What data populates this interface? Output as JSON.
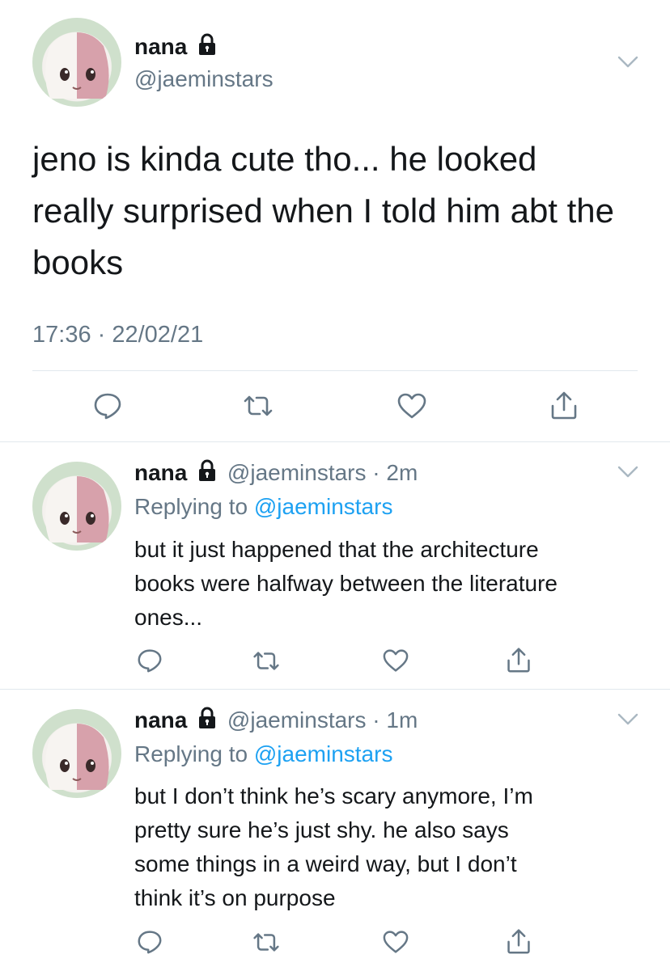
{
  "main_tweet": {
    "display_name": "nana",
    "handle": "@jaeminstars",
    "text": "jeno is kinda cute tho... he looked\nreally surprised when I told him abt the\nbooks",
    "timestamp": "17:36 · 22/02/21"
  },
  "replies": [
    {
      "display_name": "nana",
      "handle_time": "@jaeminstars · 2m",
      "replying_prefix": "Replying to ",
      "replying_to": "@jaeminstars",
      "text": "but it just happened that the architecture\nbooks were halfway between the literature\nones..."
    },
    {
      "display_name": "nana",
      "handle_time": "@jaeminstars · 1m",
      "replying_prefix": "Replying to ",
      "replying_to": "@jaeminstars",
      "text": "but I don’t think he’s scary anymore, I’m\npretty sure he’s just shy. he also says\nsome things in a weird way, but I don’t\nthink it’s on purpose"
    }
  ],
  "icons": [
    "lock-icon",
    "chevron-down-icon",
    "reply-icon",
    "retweet-icon",
    "like-icon",
    "share-icon"
  ],
  "colors": {
    "text": "#14171a",
    "secondary": "#657786",
    "link": "#1da1f2",
    "divider": "#e1e8ed",
    "icon": "#657786"
  }
}
